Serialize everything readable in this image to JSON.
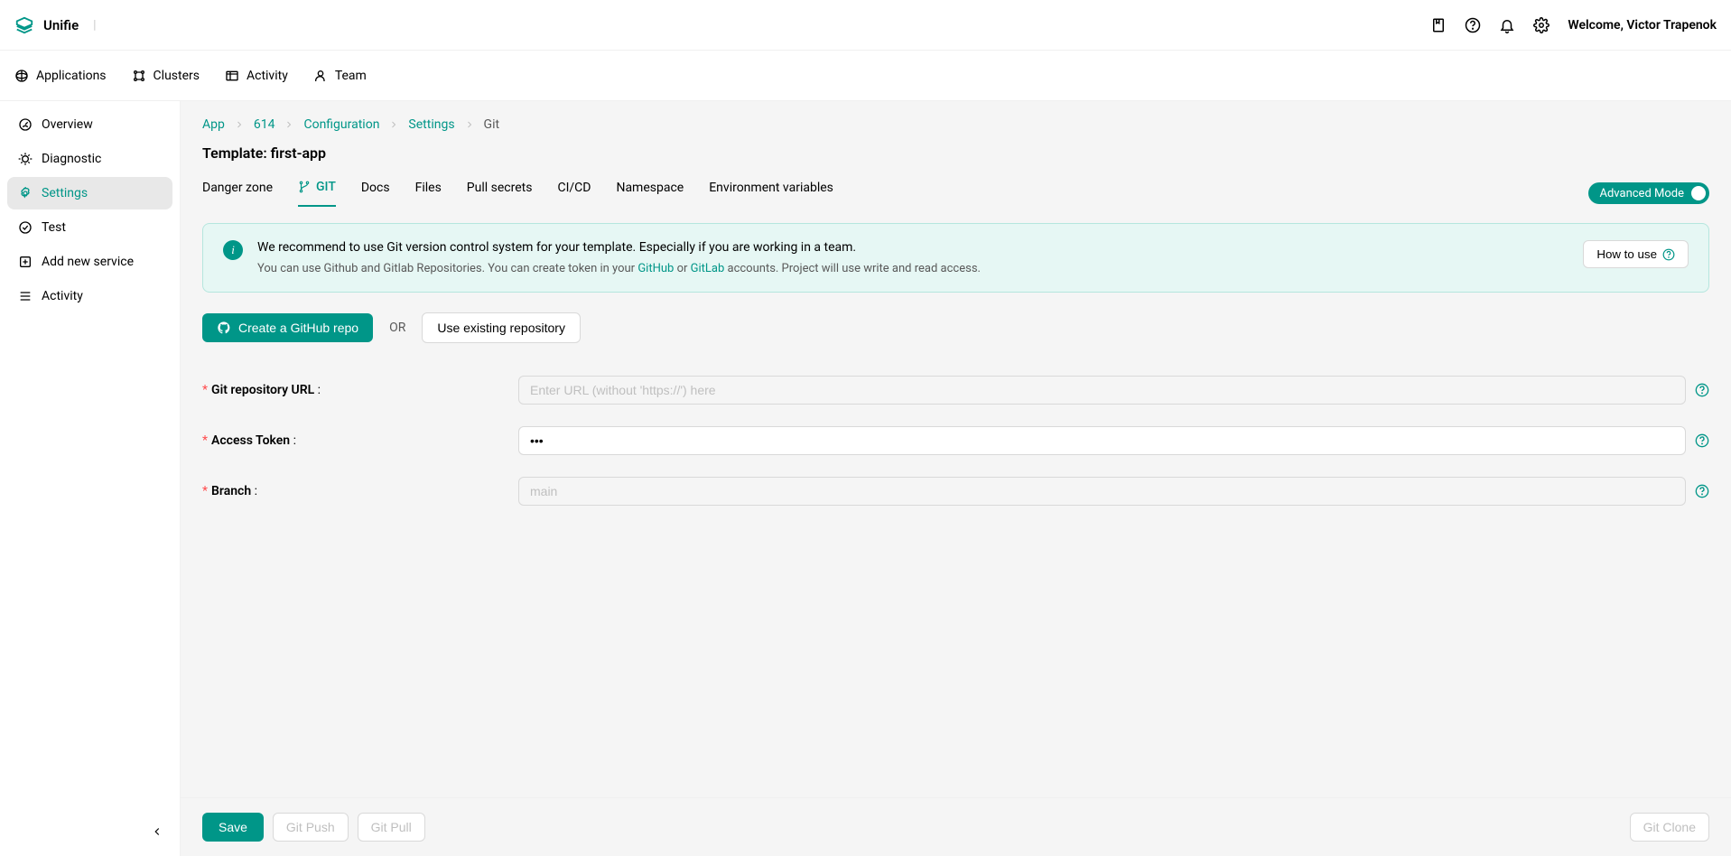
{
  "brand": "Unifie",
  "header": {
    "welcome": "Welcome, Victor Trapenok"
  },
  "nav": {
    "applications": "Applications",
    "clusters": "Clusters",
    "activity": "Activity",
    "team": "Team"
  },
  "sidebar": {
    "overview": "Overview",
    "diagnostic": "Diagnostic",
    "settings": "Settings",
    "test": "Test",
    "add_new_service": "Add new service",
    "activity": "Activity"
  },
  "breadcrumb": {
    "app": "App",
    "id": "614",
    "configuration": "Configuration",
    "settings": "Settings",
    "git": "Git"
  },
  "page_title": "Template: first-app",
  "tabs": {
    "danger_zone": "Danger zone",
    "git": "GIT",
    "docs": "Docs",
    "files": "Files",
    "pull_secrets": "Pull secrets",
    "cicd": "CI/CD",
    "namespace": "Namespace",
    "env_vars": "Environment variables"
  },
  "advanced_mode": "Advanced Mode",
  "alert": {
    "main": "We recommend to use Git version control system for your template. Especially if you are working in a team.",
    "sub_prefix": "You can use Github and Gitlab Repositories. You can create token in your ",
    "github": "GitHub",
    "or": " or ",
    "gitlab": "GitLab",
    "sub_suffix": " accounts. Project will use write and read access.",
    "how_to": "How to use"
  },
  "actions": {
    "create_github": "Create a GitHub repo",
    "or": "OR",
    "use_existing": "Use existing repository"
  },
  "form": {
    "repo_url": {
      "label": "Git repository URL",
      "placeholder": "Enter URL (without 'https://') here",
      "value": ""
    },
    "token": {
      "label": "Access Token",
      "value": "•••"
    },
    "branch": {
      "label": "Branch",
      "placeholder": "main",
      "value": ""
    }
  },
  "footer": {
    "save": "Save",
    "git_push": "Git Push",
    "git_pull": "Git Pull",
    "git_clone": "Git Clone"
  }
}
